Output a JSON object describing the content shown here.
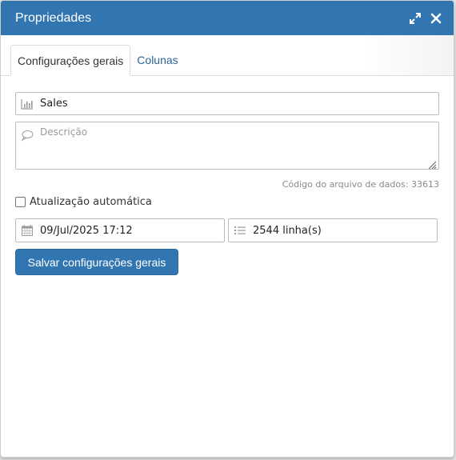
{
  "dialog": {
    "title": "Propriedades",
    "actions": {
      "expand_icon": "expand-icon",
      "close_icon": "close-icon"
    }
  },
  "tabs": [
    {
      "label": "Configurações gerais",
      "active": true
    },
    {
      "label": "Colunas",
      "active": false
    }
  ],
  "form": {
    "name_value": "Sales",
    "name_icon": "bar-chart-icon",
    "description_placeholder": "Descrição",
    "description_icon": "speech-bubble-icon",
    "file_code_text": "Código do arquivo de dados: 33613",
    "auto_update_label": "Atualização automática",
    "auto_update_checked": false,
    "date_value": "09/Jul/2025 17:12",
    "date_icon": "calendar-icon",
    "rows_value": "2544 linha(s)",
    "rows_icon": "list-icon",
    "save_label": "Salvar configurações gerais"
  },
  "colors": {
    "accent": "#3276b1",
    "link": "#2a6496"
  }
}
